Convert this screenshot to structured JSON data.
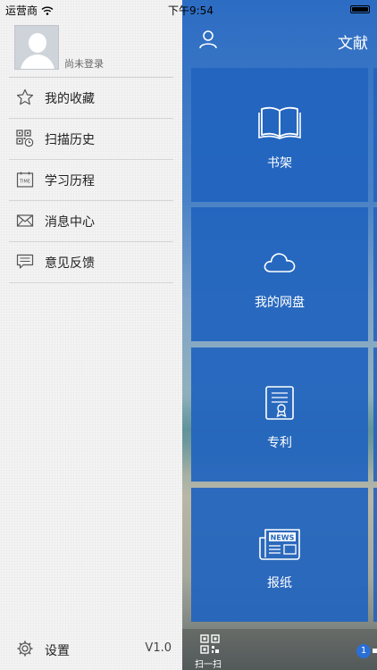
{
  "status_bar": {
    "carrier": "运营商",
    "time": "下午9:54"
  },
  "drawer": {
    "user": {
      "login_text": "尚未登录"
    },
    "menu": [
      {
        "label": "我的收藏",
        "icon": "star-icon"
      },
      {
        "label": "扫描历史",
        "icon": "qr-code-history-icon"
      },
      {
        "label": "学习历程",
        "icon": "calendar-time-icon"
      },
      {
        "label": "消息中心",
        "icon": "envelope-icon"
      },
      {
        "label": "意见反馈",
        "icon": "chat-bubble-icon"
      }
    ],
    "settings": {
      "label": "设置",
      "version": "V1.0"
    }
  },
  "main": {
    "title": "文献",
    "tiles": [
      {
        "label": "书架",
        "icon": "open-book-icon"
      },
      {
        "label": "我的网盘",
        "icon": "cloud-icon"
      },
      {
        "label": "专利",
        "icon": "certificate-document-icon"
      },
      {
        "label": "报纸",
        "icon": "newspaper-icon",
        "icon_text": "NEWS"
      }
    ],
    "bottom": {
      "scan_label": "扫一扫",
      "badge_count": "1"
    }
  },
  "colors": {
    "tile_blue": "#2164be",
    "drawer_bg": "#f2f2f2"
  }
}
